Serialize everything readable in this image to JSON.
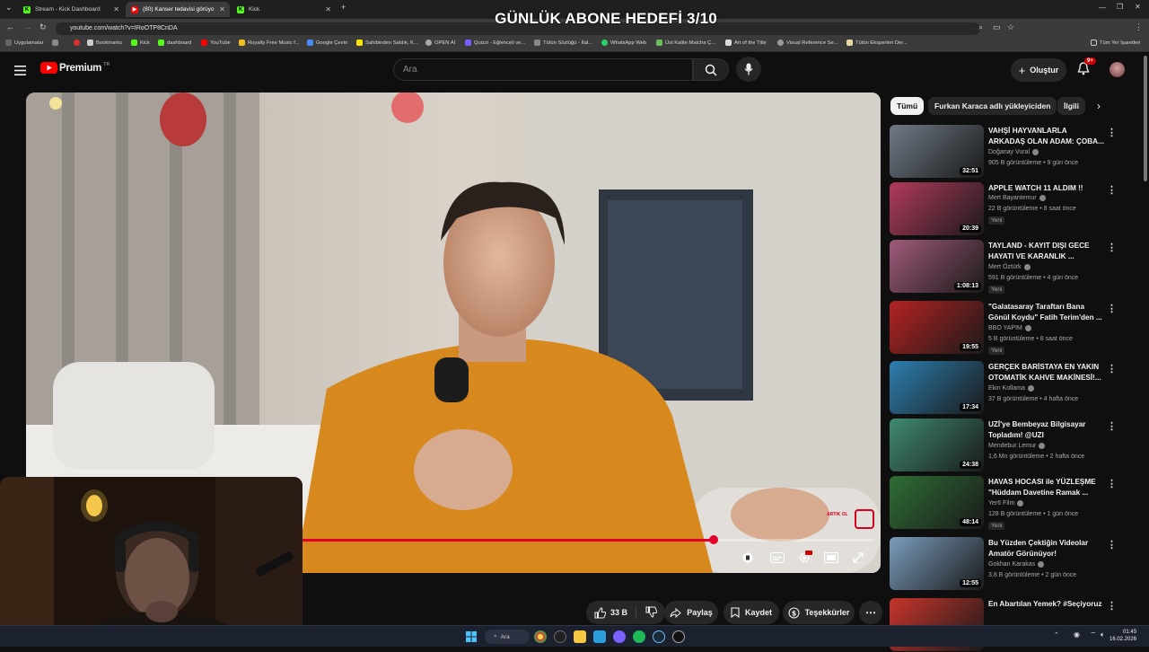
{
  "overlay": {
    "title": "GÜNLÜK ABONE HEDEFİ 3/10"
  },
  "browser": {
    "tabs": [
      {
        "label": "Stream - Kick Dashboard",
        "active": false
      },
      {
        "label": "(80) Kanser tedavisi görüyo",
        "active": true
      },
      {
        "label": "Kick",
        "active": false
      }
    ],
    "new_tab": "+",
    "url": "youtube.com/watch?v=IRoOTP8CnDA",
    "bookmarks": [
      "Uygulamalar",
      "Bookmarks",
      "Kick",
      "dashboard",
      "YouTube",
      "Royalty Free Music f...",
      "Google Çeviri",
      "Sahibinden Satılık, K...",
      "OPEN AI",
      "Quizzi - Eğlenceli ve...",
      "Tütün Sözlüğü - İtal...",
      "WhatsApp Web",
      "Üst Kalite Matcha Ç...",
      "Art of the Title",
      "Visual Reference Se...",
      "Tütün Eksperleri Der..."
    ],
    "all_bookmarks": "Tüm Yer İşaretleri"
  },
  "youtube": {
    "logo_text": "Premium",
    "logo_region": "TR",
    "search_placeholder": "Ara",
    "create_label": "Oluştur",
    "notification_badge": "9+",
    "chips": [
      "Tümü",
      "Furkan Karaca adlı yükleyiciden",
      "İlgili"
    ],
    "actions": {
      "like_count": "33 B",
      "share": "Paylaş",
      "save": "Kaydet",
      "thanks": "Teşekkürler"
    },
    "video": {
      "progress": 0.72,
      "watermark": "ARTIK OL"
    }
  },
  "recommendations": [
    {
      "title": "VAHŞİ HAYVANLARLA ARKADAŞ OLAN ADAM: ÇOBA...",
      "channel": "Doğanay Vural",
      "views": "905 B görüntüleme",
      "age": "9 gün önce",
      "duration": "32:51",
      "new": "",
      "thumb_color": "#6f7a86"
    },
    {
      "title": "APPLE WATCH 11 ALDIM !!",
      "channel": "Mert Bayantemur",
      "views": "22 B görüntüleme",
      "age": "8 saat önce",
      "duration": "20:39",
      "new": "Yeni",
      "thumb_color": "#b23a5c"
    },
    {
      "title": "TAYLAND - KAYIT DIŞI GECE HAYATI VE KARANLIK ...",
      "channel": "Mert Öztürk",
      "views": "591 B görüntüleme",
      "age": "4 gün önce",
      "duration": "1:08:13",
      "new": "Yeni",
      "thumb_color": "#a05a7a"
    },
    {
      "title": "\"Galatasaray Taraftarı Bana Gönül Koydu\" Fatih Terim'den ...",
      "channel": "BBO YAPIM",
      "views": "5 B görüntüleme",
      "age": "8 saat önce",
      "duration": "19:55",
      "new": "Yeni",
      "thumb_color": "#b52222"
    },
    {
      "title": "GERÇEK BARİSTAYA EN YAKIN OTOMATİK KAHVE MAKİNESİ!...",
      "channel": "Ekin Kollama",
      "views": "37 B görüntüleme",
      "age": "4 hafta önce",
      "duration": "17:34",
      "new": "",
      "thumb_color": "#2d7fb0"
    },
    {
      "title": "UZİ'ye Bembeyaz Bilgisayar Topladım! @UZI",
      "channel": "Mendebur Lemur",
      "views": "1,6 Mn görüntüleme",
      "age": "2 hafta önce",
      "duration": "24:38",
      "new": "",
      "thumb_color": "#3f8a73"
    },
    {
      "title": "HAVAS HOCASI ile YÜZLEŞME \"Hüddam Davetine Ramak ...",
      "channel": "Yer6 Film",
      "views": "128 B görüntüleme",
      "age": "1 gün önce",
      "duration": "48:14",
      "new": "Yeni",
      "thumb_color": "#2f6e35"
    },
    {
      "title": "Bu Yüzden Çektiğin Videolar Amatör Görünüyor!",
      "channel": "Gokhan Karakas",
      "views": "3,8 B görüntüleme",
      "age": "2 gün önce",
      "duration": "12:55",
      "new": "",
      "thumb_color": "#7b9dbd"
    },
    {
      "title": "En Abartılan Yemek? #Seçiyoruz",
      "channel": "",
      "views": "",
      "age": "",
      "duration": "",
      "new": "",
      "thumb_color": "#c8342b"
    }
  ],
  "taskbar": {
    "search_label": "Ara",
    "time": "01:45",
    "date": "16.02.2026"
  }
}
